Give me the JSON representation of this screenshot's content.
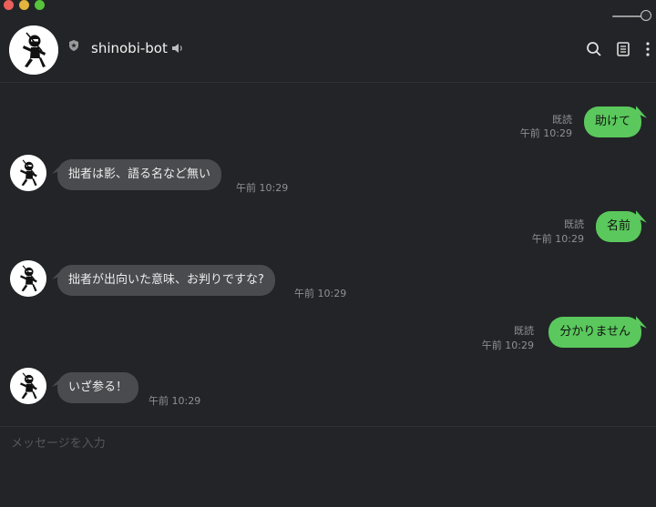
{
  "header": {
    "title": "shinobi-bot"
  },
  "composer": {
    "placeholder": "メッセージを入力"
  },
  "messages": [
    {
      "direction": "out",
      "text": "助けて",
      "read": "既読",
      "time": "午前 10:29"
    },
    {
      "direction": "in",
      "text": "拙者は影、語る名など無い",
      "time": "午前 10:29"
    },
    {
      "direction": "out",
      "text": "名前",
      "read": "既読",
      "time": "午前 10:29"
    },
    {
      "direction": "in",
      "text": "拙者が出向いた意味、お判りですな?",
      "time": "午前 10:29"
    },
    {
      "direction": "out",
      "text": "分かりません",
      "read": "既読",
      "time": "午前 10:29"
    },
    {
      "direction": "in",
      "text": "いざ参る！",
      "time": "午前 10:29"
    }
  ],
  "colors": {
    "background": "#222427",
    "incoming_bubble": "#4a4b4f",
    "outgoing_bubble": "#5ac85c",
    "meta_text": "#8e9095"
  },
  "icons": {
    "header": [
      "shield-icon",
      "speaker-icon",
      "search-icon",
      "notes-icon",
      "more-icon"
    ],
    "avatar": "ninja-avatar-icon"
  }
}
